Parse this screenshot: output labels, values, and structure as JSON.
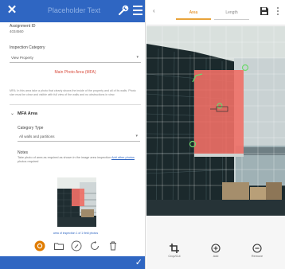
{
  "left_panel": {
    "title": "Placeholder Text",
    "assignment_label": "Assignment ID",
    "assignment_value": "4034560",
    "inspection_label": "Inspection Category",
    "inspection_value": "View Property",
    "red_link": "Main Photo Area (MFA)",
    "notice": "MFA: In this area take a photo that clearly shows the inside of the property and all of its walls. Photo size must be clear and visible with full view of the walls and no obstructions in view.",
    "mfa_section_title": "MFA Area",
    "category_label": "Category Type",
    "category_value": "All walls and partitions",
    "notes_label": "Notes",
    "notes_text": "Take photo of area as required as shown in the image area inspection",
    "notes_link": "Add other photos",
    "notes_suffix": "photos required",
    "thumbnail_caption": "area of inspection 1 of 1 field photos"
  },
  "right_panel": {
    "tab_area": "Area",
    "tab_length": "Length",
    "tools": [
      {
        "label": "Crop/Cut",
        "icon": "crop-icon"
      },
      {
        "label": "Add",
        "icon": "add-circle-icon"
      },
      {
        "label": "Remove",
        "icon": "remove-circle-icon"
      }
    ]
  },
  "colors": {
    "primary": "#2f66c2",
    "accent_orange": "#e07c00",
    "alert_red": "#d84b3c",
    "overlay_red": "#ef6f66",
    "overlay_green": "#6ed96e"
  }
}
